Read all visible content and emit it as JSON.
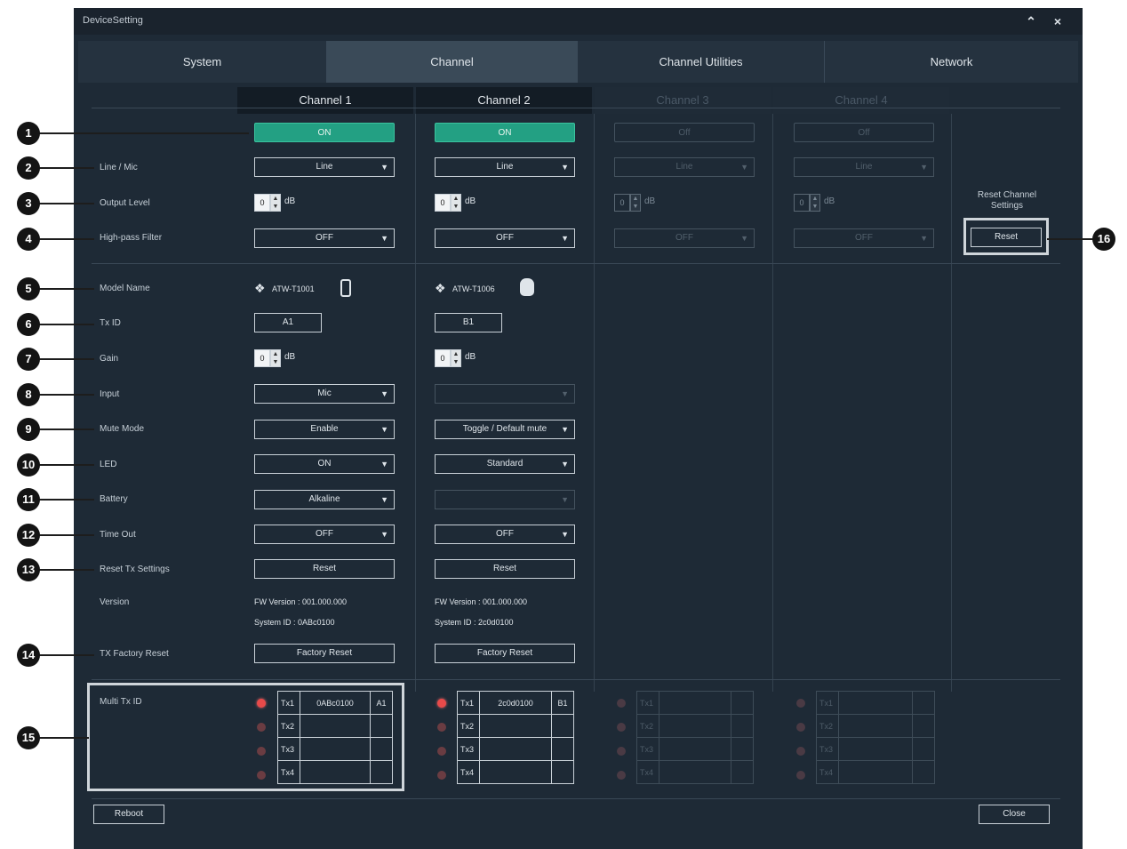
{
  "window": {
    "title": "DeviceSetting",
    "collapse_icon": "chevron-up-icon",
    "close_icon": "close-icon"
  },
  "tabs": [
    "System",
    "Channel",
    "Channel Utilities",
    "Network"
  ],
  "active_tab": "Channel",
  "channels": [
    "Channel 1",
    "Channel 2",
    "Channel 3",
    "Channel 4"
  ],
  "labels": {
    "line_mic": "Line / Mic",
    "output_level": "Output Level",
    "high_pass": "High-pass Filter",
    "model_name": "Model Name",
    "tx_id": "Tx ID",
    "gain": "Gain",
    "input": "Input",
    "mute_mode": "Mute Mode",
    "led": "LED",
    "battery": "Battery",
    "time_out": "Time Out",
    "reset_tx": "Reset Tx Settings",
    "version": "Version",
    "tx_factory_reset": "TX Factory Reset",
    "multi_tx_id": "Multi Tx ID",
    "reset_channel_settings": "Reset Channel Settings"
  },
  "power": [
    "ON",
    "ON",
    "Off",
    "Off"
  ],
  "line_mic": [
    "Line",
    "Line",
    "Line",
    "Line"
  ],
  "output_level": {
    "value": "0",
    "unit": "dB"
  },
  "high_pass": [
    "OFF",
    "OFF",
    "OFF",
    "OFF"
  ],
  "models": [
    "ATW-T1001",
    "ATW-T1006"
  ],
  "tx_ids": [
    "A1",
    "B1"
  ],
  "gain": {
    "value": "0",
    "unit": "dB"
  },
  "input": [
    "Mic",
    ""
  ],
  "mute_mode": [
    "Enable",
    "Toggle / Default mute"
  ],
  "led": [
    "ON",
    "Standard"
  ],
  "battery": [
    "Alkaline",
    ""
  ],
  "time_out": [
    "OFF",
    "OFF"
  ],
  "reset_label": "Reset",
  "factory_reset_label": "Factory Reset",
  "versions": [
    {
      "fw": "FW Version : 001.000.000",
      "sys": "System ID : 0ABc0100"
    },
    {
      "fw": "FW Version : 001.000.000",
      "sys": "System ID : 2c0d0100"
    }
  ],
  "multi": [
    {
      "rows": [
        "Tx1",
        "Tx2",
        "Tx3",
        "Tx4"
      ],
      "id": "0ABc0100",
      "slot": "A1"
    },
    {
      "rows": [
        "Tx1",
        "Tx2",
        "Tx3",
        "Tx4"
      ],
      "id": "2c0d0100",
      "slot": "B1"
    },
    {
      "rows": [
        "Tx1",
        "Tx2",
        "Tx3",
        "Tx4"
      ],
      "id": "",
      "slot": ""
    },
    {
      "rows": [
        "Tx1",
        "Tx2",
        "Tx3",
        "Tx4"
      ],
      "id": "",
      "slot": ""
    }
  ],
  "reset_channel_button": "Reset",
  "footer": {
    "reboot": "Reboot",
    "close": "Close"
  },
  "callouts": [
    "1",
    "2",
    "3",
    "4",
    "5",
    "6",
    "7",
    "8",
    "9",
    "10",
    "11",
    "12",
    "13",
    "14",
    "15",
    "16"
  ],
  "colors": {
    "panel": "#1e2a36",
    "accent_on": "#23a083",
    "led_red": "#e84a4a"
  }
}
